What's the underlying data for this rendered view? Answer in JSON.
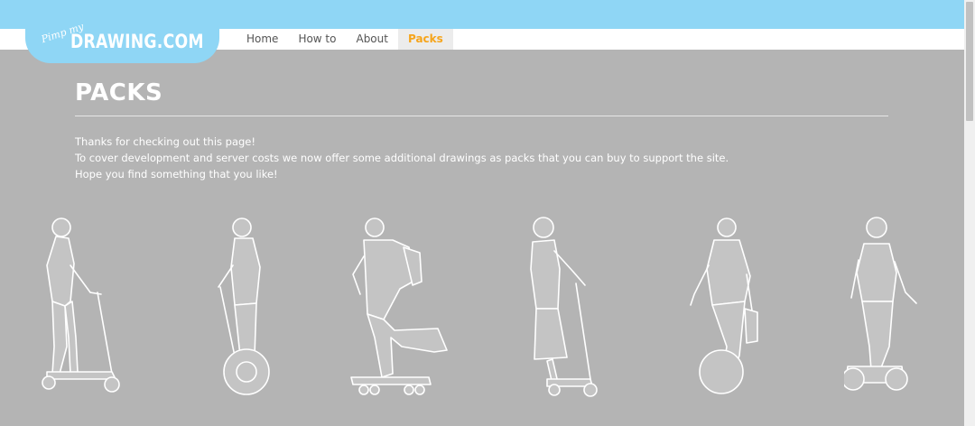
{
  "header": {
    "logo_small": "Pimp my",
    "logo_big": "DRAWING.COM",
    "nav": [
      {
        "label": "Home"
      },
      {
        "label": "How to"
      },
      {
        "label": "About"
      },
      {
        "label": "Packs",
        "active": true
      }
    ]
  },
  "main": {
    "title": "PACKS",
    "intro": [
      "Thanks for checking out this page!",
      "To cover development and server costs we now offer some additional drawings as packs that you can buy to support the site.",
      "Hope you find something that you like!"
    ]
  },
  "gallery": {
    "items": [
      {
        "icon": "person-on-kick-scooter-drawing"
      },
      {
        "icon": "person-on-segway-drawing"
      },
      {
        "icon": "person-on-skateboard-drawing"
      },
      {
        "icon": "person-on-kick-scooter-drawing"
      },
      {
        "icon": "person-on-monowheel-drawing"
      },
      {
        "icon": "person-on-segway-drawing"
      }
    ]
  },
  "colors": {
    "header_bg": "#8fd6f5",
    "page_bg": "#b4b4b4",
    "active_nav": "#f6a51c"
  }
}
